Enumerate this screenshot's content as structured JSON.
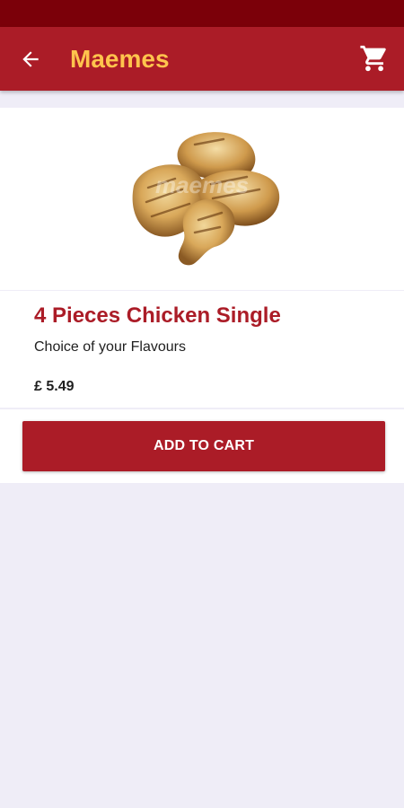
{
  "app_bar": {
    "title": "Maemes",
    "back_icon": "arrow-left-icon",
    "cart_icon": "shopping-cart-icon"
  },
  "product": {
    "image_icon": "chicken-pieces-image",
    "name": "4 Pieces Chicken Single",
    "description": "Choice of your Flavours",
    "price": "£ 5.49"
  },
  "actions": {
    "add_to_cart_label": "ADD TO CART"
  },
  "colors": {
    "status_bar": "#7b0009",
    "primary": "#ab1c27",
    "title_accent": "#ffc44d",
    "background": "#efedf7"
  }
}
